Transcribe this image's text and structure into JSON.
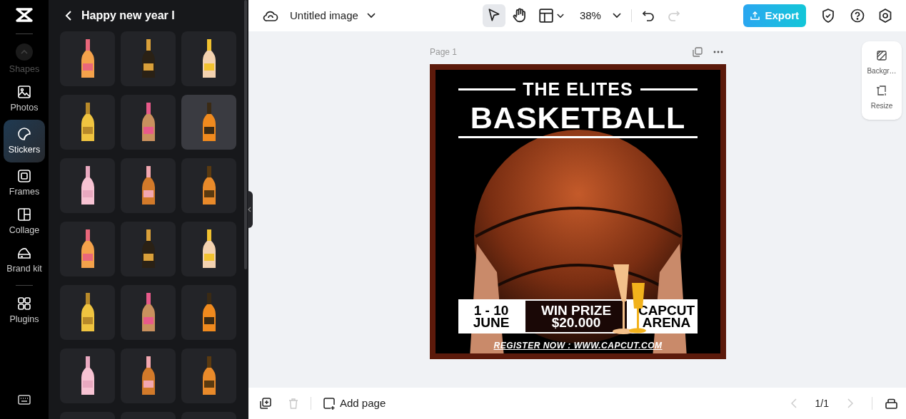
{
  "rail": {
    "items": [
      {
        "label": "Shapes",
        "kind": "scroll",
        "selected": false,
        "faded": true
      },
      {
        "label": "Photos",
        "kind": "photos",
        "selected": false,
        "faded": false
      },
      {
        "label": "Stickers",
        "kind": "stickers",
        "selected": true,
        "faded": false
      },
      {
        "label": "Frames",
        "kind": "frames",
        "selected": false,
        "faded": false
      },
      {
        "label": "Collage",
        "kind": "collage",
        "selected": false,
        "faded": false
      },
      {
        "label": "Brand kit",
        "kind": "brand",
        "selected": false,
        "faded": false
      },
      {
        "label": "Plugins",
        "kind": "plugins",
        "selected": false,
        "faded": false
      }
    ]
  },
  "panel": {
    "title": "Happy new year I",
    "stickers": [
      {
        "hovered": false
      },
      {
        "hovered": false
      },
      {
        "hovered": false
      },
      {
        "hovered": false
      },
      {
        "hovered": false
      },
      {
        "hovered": true
      },
      {
        "hovered": false
      },
      {
        "hovered": false
      },
      {
        "hovered": false
      },
      {
        "hovered": false
      },
      {
        "hovered": false
      },
      {
        "hovered": false
      },
      {
        "hovered": false
      },
      {
        "hovered": false
      },
      {
        "hovered": false
      },
      {
        "hovered": false
      },
      {
        "hovered": false
      },
      {
        "hovered": false
      },
      {
        "hovered": false
      },
      {
        "hovered": false
      },
      {
        "hovered": false
      }
    ]
  },
  "topbar": {
    "file_name": "Untitled image",
    "zoom": "38%",
    "tools": [
      {
        "kind": "select",
        "selected": true
      },
      {
        "kind": "hand",
        "selected": false
      },
      {
        "kind": "layout",
        "selected": false
      }
    ],
    "redo_disabled": true,
    "export": "Export"
  },
  "canvas": {
    "page_label": "Page 1",
    "poster": {
      "kicker": "THE ELITES",
      "title": "BASKETBALL",
      "date": [
        "1 - 10",
        "JUNE"
      ],
      "prize": [
        "WIN PRIZE",
        "$20.000"
      ],
      "venue": [
        "CAPCUT",
        "ARENA"
      ],
      "register": "REGISTER NOW : WWW.CAPCUT.COM"
    }
  },
  "side_tools": [
    {
      "label": "Backgr…",
      "kind": "background"
    },
    {
      "label": "Resize",
      "kind": "resize"
    }
  ],
  "bottom": {
    "delete_disabled": true,
    "add_page": "Add page",
    "page_count": "1/1",
    "prev_disabled": true,
    "next_disabled": true
  }
}
